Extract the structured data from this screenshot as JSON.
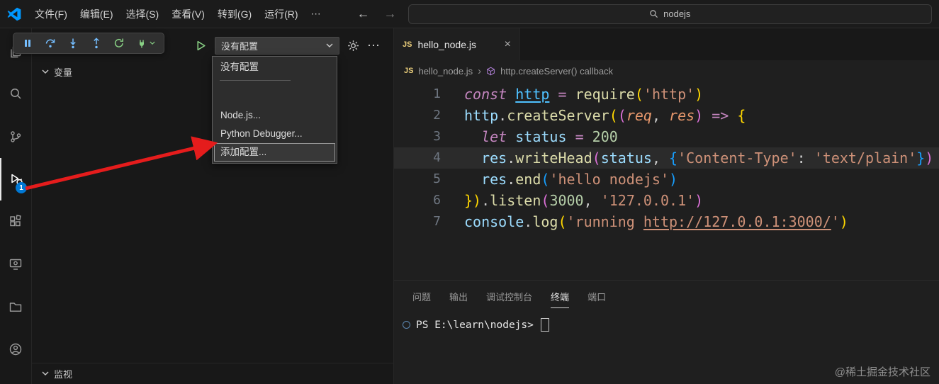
{
  "title_bar": {
    "menus": [
      "文件(F)",
      "编辑(E)",
      "选择(S)",
      "查看(V)",
      "转到(G)",
      "运行(R)",
      "⋯"
    ],
    "nav": {
      "back": "←",
      "forward": "→"
    },
    "search": {
      "value": "nodejs"
    }
  },
  "activity_bar": {
    "debug_badge": "1"
  },
  "sidebar": {
    "variables_label": "变量",
    "watch_label": "监视",
    "run_row": {
      "config_selected": "没有配置",
      "more_icon": "⋯"
    },
    "config_menu": {
      "items": [
        "没有配置",
        "Node.js...",
        "Python Debugger...",
        "添加配置..."
      ]
    }
  },
  "editor": {
    "tab": {
      "lang_badge": "JS",
      "name": "hello_node.js",
      "close_icon": "×"
    },
    "breadcrumb": {
      "lang_badge": "JS",
      "file": "hello_node.js",
      "separator": "›",
      "symbol": "http.createServer() callback"
    },
    "code": {
      "lines": [
        {
          "n": "1",
          "t": [
            [
              "const ",
              "kw"
            ],
            [
              "http",
              "cv"
            ],
            [
              " ",
              "pl"
            ],
            [
              "=",
              "op"
            ],
            [
              " ",
              "pl"
            ],
            [
              "require",
              "fn"
            ],
            [
              "(",
              "b1"
            ],
            [
              "'http'",
              "st"
            ],
            [
              ")",
              "b1"
            ]
          ]
        },
        {
          "n": "2",
          "t": [
            [
              "http",
              "vr"
            ],
            [
              ".",
              "pl"
            ],
            [
              "createServer",
              "fn"
            ],
            [
              "(",
              "b1"
            ],
            [
              "(",
              "b2"
            ],
            [
              "req",
              "pm"
            ],
            [
              ",",
              "pl"
            ],
            [
              " ",
              "pl"
            ],
            [
              "res",
              "pm"
            ],
            [
              ")",
              "b2"
            ],
            [
              " ",
              "pl"
            ],
            [
              "=>",
              "op"
            ],
            [
              " ",
              "pl"
            ],
            [
              "{",
              "b1"
            ]
          ]
        },
        {
          "n": "3",
          "t": [
            [
              "  ",
              "pl"
            ],
            [
              "let",
              "kw"
            ],
            [
              " ",
              "pl"
            ],
            [
              "status",
              "vr"
            ],
            [
              " ",
              "pl"
            ],
            [
              "=",
              "op"
            ],
            [
              " ",
              "pl"
            ],
            [
              "200",
              "nm"
            ]
          ]
        },
        {
          "n": "4",
          "hl": true,
          "t": [
            [
              "  ",
              "pl"
            ],
            [
              "res",
              "vr"
            ],
            [
              ".",
              "pl"
            ],
            [
              "writeHead",
              "fn"
            ],
            [
              "(",
              "b2"
            ],
            [
              "status",
              "vr"
            ],
            [
              ",",
              "pl"
            ],
            [
              " ",
              "pl"
            ],
            [
              "{",
              "b3"
            ],
            [
              "'Content-Type'",
              "st"
            ],
            [
              ":",
              "pl"
            ],
            [
              " ",
              "pl"
            ],
            [
              "'text/plain'",
              "st"
            ],
            [
              "}",
              "b3"
            ],
            [
              ")",
              "b2"
            ]
          ]
        },
        {
          "n": "5",
          "t": [
            [
              "  ",
              "pl"
            ],
            [
              "res",
              "vr"
            ],
            [
              ".",
              "pl"
            ],
            [
              "end",
              "fn"
            ],
            [
              "(",
              "b3"
            ],
            [
              "'hello nodejs'",
              "st"
            ],
            [
              ")",
              "b3"
            ]
          ]
        },
        {
          "n": "6",
          "t": [
            [
              "}",
              "b1"
            ],
            [
              ")",
              "b1"
            ],
            [
              ".",
              "pl"
            ],
            [
              "listen",
              "fn"
            ],
            [
              "(",
              "b2"
            ],
            [
              "3000",
              "nm"
            ],
            [
              ",",
              "pl"
            ],
            [
              " ",
              "pl"
            ],
            [
              "'127.0.0.1'",
              "st"
            ],
            [
              ")",
              "b2"
            ]
          ]
        },
        {
          "n": "7",
          "t": [
            [
              "console",
              "vr"
            ],
            [
              ".",
              "pl"
            ],
            [
              "log",
              "fn"
            ],
            [
              "(",
              "b1"
            ],
            [
              "'running ",
              "st"
            ],
            [
              "http://127.0.0.1:3000/",
              "stu"
            ],
            [
              "'",
              "st"
            ],
            [
              ")",
              "b1"
            ]
          ]
        }
      ]
    }
  },
  "panel": {
    "tabs": [
      "问题",
      "输出",
      "调试控制台",
      "终端",
      "端口"
    ],
    "active_tab": "终端",
    "terminal": {
      "prompt": "PS E:\\learn\\nodejs> "
    }
  },
  "watermark": "@稀土掘金技术社区"
}
